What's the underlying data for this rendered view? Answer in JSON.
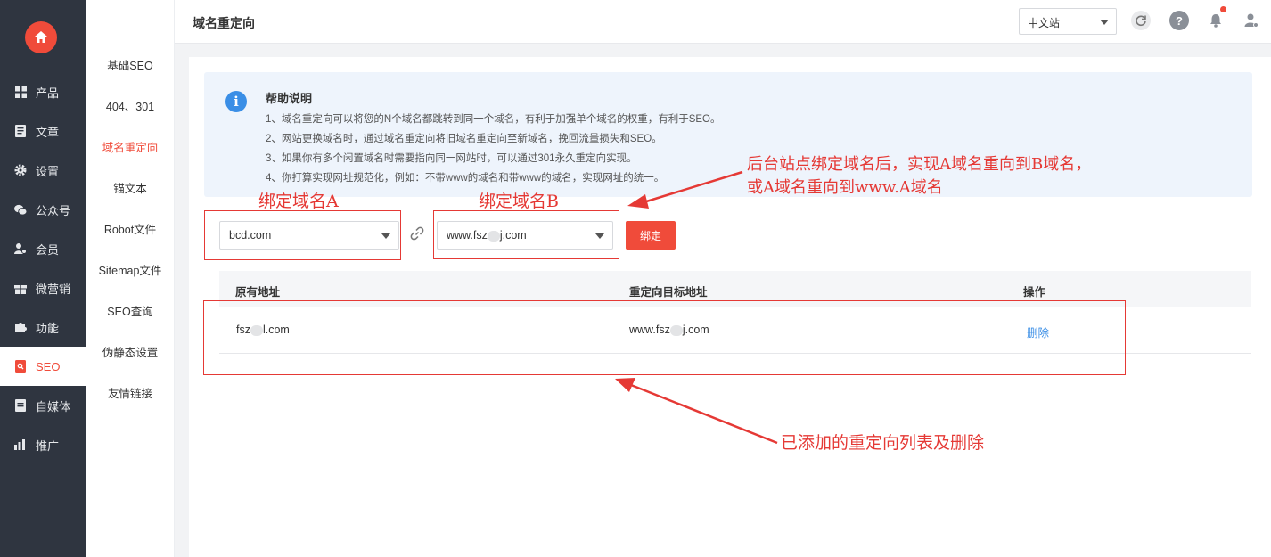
{
  "sidebar": {
    "items": [
      {
        "label": "产品",
        "icon": "grid-icon"
      },
      {
        "label": "文章",
        "icon": "document-icon"
      },
      {
        "label": "设置",
        "icon": "gear-icon"
      },
      {
        "label": "公众号",
        "icon": "wechat-icon"
      },
      {
        "label": "会员",
        "icon": "member-icon"
      },
      {
        "label": "微营销",
        "icon": "gift-icon"
      },
      {
        "label": "功能",
        "icon": "puzzle-icon"
      },
      {
        "label": "SEO",
        "icon": "seo-icon",
        "active": true
      },
      {
        "label": "自媒体",
        "icon": "media-icon"
      },
      {
        "label": "推广",
        "icon": "promote-icon"
      }
    ]
  },
  "subnav": {
    "items": [
      {
        "label": "基础SEO"
      },
      {
        "label": "404、301"
      },
      {
        "label": "域名重定向",
        "active": true
      },
      {
        "label": "锚文本"
      },
      {
        "label": "Robot文件"
      },
      {
        "label": "Sitemap文件"
      },
      {
        "label": "SEO查询"
      },
      {
        "label": "伪静态设置"
      },
      {
        "label": "友情链接"
      }
    ]
  },
  "header": {
    "title": "域名重定向",
    "language": "中文站"
  },
  "help": {
    "title": "帮助说明",
    "lines": [
      "1、域名重定向可以将您的N个域名都跳转到同一个域名，有利于加强单个域名的权重，有利于SEO。",
      "2、网站更换域名时，通过域名重定向将旧域名重定向至新域名，挽回流量损失和SEO。",
      "3、如果你有多个闲置域名时需要指向同一网站时，可以通过301永久重定向实现。",
      "4、你打算实现网址规范化，例如：不带www的域名和带www的域名，实现网址的统一。"
    ]
  },
  "form": {
    "domain_a": "bcd.com",
    "domain_b_prefix": "www.fsz",
    "domain_b_suffix": "j.com",
    "bind_label": "绑定"
  },
  "table": {
    "headers": [
      "原有地址",
      "重定向目标地址",
      "操作"
    ],
    "rows": [
      {
        "source_prefix": "fsz",
        "source_suffix": "l.com",
        "target_prefix": "www.fsz",
        "target_suffix": "j.com",
        "action": "删除"
      }
    ]
  },
  "annotations": {
    "label_a": "绑定域名A",
    "label_b": "绑定域名B",
    "note_top_line1": "后台站点绑定域名后，实现A域名重向到B域名，",
    "note_top_line2": "或A域名重向到www.A域名",
    "note_bottom": "已添加的重定向列表及删除"
  },
  "colors": {
    "accent": "#f04b3a",
    "sidebar_bg": "#2f3540",
    "link": "#3a8ee6",
    "annotation": "#e53935"
  }
}
